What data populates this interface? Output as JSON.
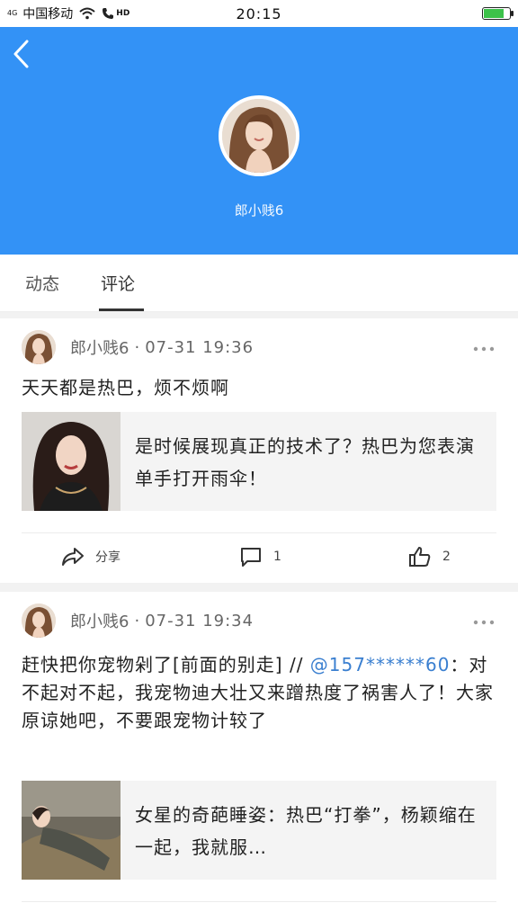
{
  "status_bar": {
    "network_label": "4G",
    "carrier": "中国移动",
    "hd_label": "HD",
    "time": "20:15",
    "battery_percent": 80
  },
  "profile": {
    "name": "郎小贱6"
  },
  "tabs": [
    {
      "label": "动态",
      "active": false
    },
    {
      "label": "评论",
      "active": true
    }
  ],
  "comments": [
    {
      "author": "郎小贱6",
      "separator": "·",
      "time": "07-31 19:36",
      "text": "天天都是热巴，烦不烦啊",
      "mention": "",
      "text_after": "",
      "quote_text": "是时候展现真正的技术了？热巴为您表演单手打开雨伞！",
      "share_label": "分享",
      "comment_count": "1",
      "like_count": "2"
    },
    {
      "author": "郎小贱6",
      "separator": "·",
      "time": "07-31 19:34",
      "text": "赶快把你宠物剁了[前面的别走] // ",
      "mention": "@157******60",
      "text_after": "：对不起对不起，我宠物迪大壮又来蹭热度了祸害人了！大家原谅她吧，不要跟宠物计较了",
      "quote_text": "女星的奇葩睡姿：热巴“打拳”，杨颖缩在一起，我就服…"
    }
  ],
  "colors": {
    "header_blue": "#3392f6",
    "mention_blue": "#3a7fd0",
    "battery_green": "#3cc24a"
  },
  "icons": [
    "wifi-icon",
    "phone-call-icon",
    "battery-icon",
    "back-arrow-icon",
    "more-dots-icon",
    "share-icon",
    "comment-icon",
    "like-icon"
  ]
}
